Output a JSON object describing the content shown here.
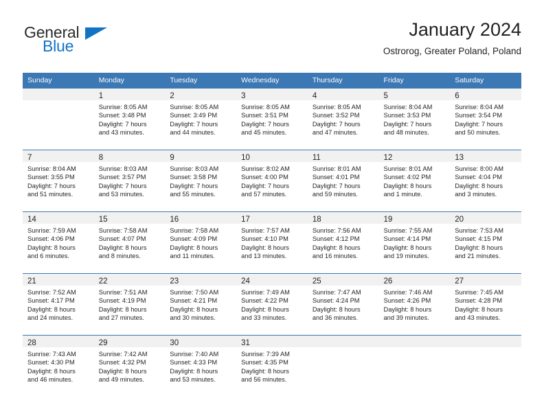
{
  "brand": {
    "name_part1": "General",
    "name_part2": "Blue",
    "flag_icon": "blue-triangle-flag-icon"
  },
  "header": {
    "title": "January 2024",
    "subtitle": "Ostrorog, Greater Poland, Poland"
  },
  "colors": {
    "header_blue": "#3c78b4",
    "brand_blue": "#1272c4",
    "daynum_band": "#f1f1f1",
    "text": "#231f20"
  },
  "weekdays": [
    "Sunday",
    "Monday",
    "Tuesday",
    "Wednesday",
    "Thursday",
    "Friday",
    "Saturday"
  ],
  "weeks": [
    [
      {
        "day": ""
      },
      {
        "day": "1",
        "sunrise": "Sunrise: 8:05 AM",
        "sunset": "Sunset: 3:48 PM",
        "daylight1": "Daylight: 7 hours",
        "daylight2": "and 43 minutes."
      },
      {
        "day": "2",
        "sunrise": "Sunrise: 8:05 AM",
        "sunset": "Sunset: 3:49 PM",
        "daylight1": "Daylight: 7 hours",
        "daylight2": "and 44 minutes."
      },
      {
        "day": "3",
        "sunrise": "Sunrise: 8:05 AM",
        "sunset": "Sunset: 3:51 PM",
        "daylight1": "Daylight: 7 hours",
        "daylight2": "and 45 minutes."
      },
      {
        "day": "4",
        "sunrise": "Sunrise: 8:05 AM",
        "sunset": "Sunset: 3:52 PM",
        "daylight1": "Daylight: 7 hours",
        "daylight2": "and 47 minutes."
      },
      {
        "day": "5",
        "sunrise": "Sunrise: 8:04 AM",
        "sunset": "Sunset: 3:53 PM",
        "daylight1": "Daylight: 7 hours",
        "daylight2": "and 48 minutes."
      },
      {
        "day": "6",
        "sunrise": "Sunrise: 8:04 AM",
        "sunset": "Sunset: 3:54 PM",
        "daylight1": "Daylight: 7 hours",
        "daylight2": "and 50 minutes."
      }
    ],
    [
      {
        "day": "7",
        "sunrise": "Sunrise: 8:04 AM",
        "sunset": "Sunset: 3:55 PM",
        "daylight1": "Daylight: 7 hours",
        "daylight2": "and 51 minutes."
      },
      {
        "day": "8",
        "sunrise": "Sunrise: 8:03 AM",
        "sunset": "Sunset: 3:57 PM",
        "daylight1": "Daylight: 7 hours",
        "daylight2": "and 53 minutes."
      },
      {
        "day": "9",
        "sunrise": "Sunrise: 8:03 AM",
        "sunset": "Sunset: 3:58 PM",
        "daylight1": "Daylight: 7 hours",
        "daylight2": "and 55 minutes."
      },
      {
        "day": "10",
        "sunrise": "Sunrise: 8:02 AM",
        "sunset": "Sunset: 4:00 PM",
        "daylight1": "Daylight: 7 hours",
        "daylight2": "and 57 minutes."
      },
      {
        "day": "11",
        "sunrise": "Sunrise: 8:01 AM",
        "sunset": "Sunset: 4:01 PM",
        "daylight1": "Daylight: 7 hours",
        "daylight2": "and 59 minutes."
      },
      {
        "day": "12",
        "sunrise": "Sunrise: 8:01 AM",
        "sunset": "Sunset: 4:02 PM",
        "daylight1": "Daylight: 8 hours",
        "daylight2": "and 1 minute."
      },
      {
        "day": "13",
        "sunrise": "Sunrise: 8:00 AM",
        "sunset": "Sunset: 4:04 PM",
        "daylight1": "Daylight: 8 hours",
        "daylight2": "and 3 minutes."
      }
    ],
    [
      {
        "day": "14",
        "sunrise": "Sunrise: 7:59 AM",
        "sunset": "Sunset: 4:06 PM",
        "daylight1": "Daylight: 8 hours",
        "daylight2": "and 6 minutes."
      },
      {
        "day": "15",
        "sunrise": "Sunrise: 7:58 AM",
        "sunset": "Sunset: 4:07 PM",
        "daylight1": "Daylight: 8 hours",
        "daylight2": "and 8 minutes."
      },
      {
        "day": "16",
        "sunrise": "Sunrise: 7:58 AM",
        "sunset": "Sunset: 4:09 PM",
        "daylight1": "Daylight: 8 hours",
        "daylight2": "and 11 minutes."
      },
      {
        "day": "17",
        "sunrise": "Sunrise: 7:57 AM",
        "sunset": "Sunset: 4:10 PM",
        "daylight1": "Daylight: 8 hours",
        "daylight2": "and 13 minutes."
      },
      {
        "day": "18",
        "sunrise": "Sunrise: 7:56 AM",
        "sunset": "Sunset: 4:12 PM",
        "daylight1": "Daylight: 8 hours",
        "daylight2": "and 16 minutes."
      },
      {
        "day": "19",
        "sunrise": "Sunrise: 7:55 AM",
        "sunset": "Sunset: 4:14 PM",
        "daylight1": "Daylight: 8 hours",
        "daylight2": "and 19 minutes."
      },
      {
        "day": "20",
        "sunrise": "Sunrise: 7:53 AM",
        "sunset": "Sunset: 4:15 PM",
        "daylight1": "Daylight: 8 hours",
        "daylight2": "and 21 minutes."
      }
    ],
    [
      {
        "day": "21",
        "sunrise": "Sunrise: 7:52 AM",
        "sunset": "Sunset: 4:17 PM",
        "daylight1": "Daylight: 8 hours",
        "daylight2": "and 24 minutes."
      },
      {
        "day": "22",
        "sunrise": "Sunrise: 7:51 AM",
        "sunset": "Sunset: 4:19 PM",
        "daylight1": "Daylight: 8 hours",
        "daylight2": "and 27 minutes."
      },
      {
        "day": "23",
        "sunrise": "Sunrise: 7:50 AM",
        "sunset": "Sunset: 4:21 PM",
        "daylight1": "Daylight: 8 hours",
        "daylight2": "and 30 minutes."
      },
      {
        "day": "24",
        "sunrise": "Sunrise: 7:49 AM",
        "sunset": "Sunset: 4:22 PM",
        "daylight1": "Daylight: 8 hours",
        "daylight2": "and 33 minutes."
      },
      {
        "day": "25",
        "sunrise": "Sunrise: 7:47 AM",
        "sunset": "Sunset: 4:24 PM",
        "daylight1": "Daylight: 8 hours",
        "daylight2": "and 36 minutes."
      },
      {
        "day": "26",
        "sunrise": "Sunrise: 7:46 AM",
        "sunset": "Sunset: 4:26 PM",
        "daylight1": "Daylight: 8 hours",
        "daylight2": "and 39 minutes."
      },
      {
        "day": "27",
        "sunrise": "Sunrise: 7:45 AM",
        "sunset": "Sunset: 4:28 PM",
        "daylight1": "Daylight: 8 hours",
        "daylight2": "and 43 minutes."
      }
    ],
    [
      {
        "day": "28",
        "sunrise": "Sunrise: 7:43 AM",
        "sunset": "Sunset: 4:30 PM",
        "daylight1": "Daylight: 8 hours",
        "daylight2": "and 46 minutes."
      },
      {
        "day": "29",
        "sunrise": "Sunrise: 7:42 AM",
        "sunset": "Sunset: 4:32 PM",
        "daylight1": "Daylight: 8 hours",
        "daylight2": "and 49 minutes."
      },
      {
        "day": "30",
        "sunrise": "Sunrise: 7:40 AM",
        "sunset": "Sunset: 4:33 PM",
        "daylight1": "Daylight: 8 hours",
        "daylight2": "and 53 minutes."
      },
      {
        "day": "31",
        "sunrise": "Sunrise: 7:39 AM",
        "sunset": "Sunset: 4:35 PM",
        "daylight1": "Daylight: 8 hours",
        "daylight2": "and 56 minutes."
      },
      {
        "day": ""
      },
      {
        "day": ""
      },
      {
        "day": ""
      }
    ]
  ]
}
